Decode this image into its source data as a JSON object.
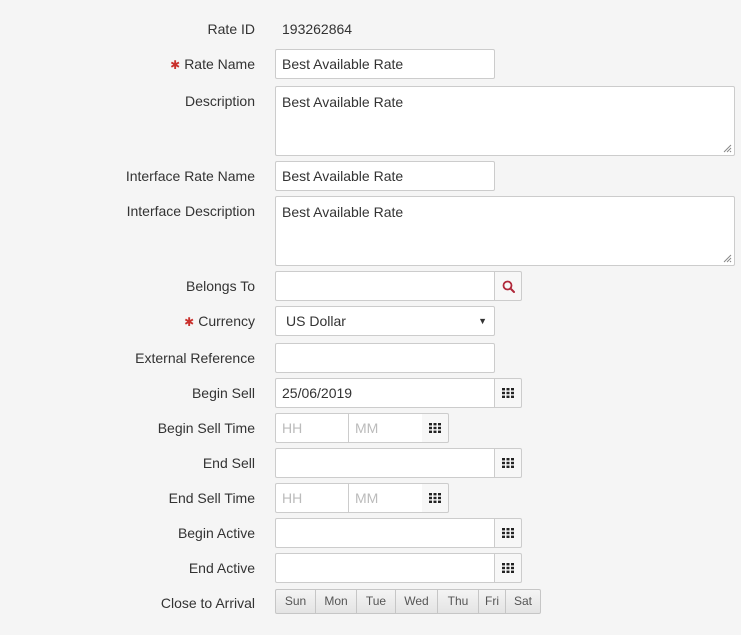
{
  "rate_id": {
    "label": "Rate ID",
    "value": "193262864"
  },
  "rate_name": {
    "label": "Rate Name",
    "required_marker": "✱",
    "value": "Best Available Rate"
  },
  "description": {
    "label": "Description",
    "value": "Best Available Rate"
  },
  "interface_rate_name": {
    "label": "Interface Rate Name",
    "value": "Best Available Rate"
  },
  "interface_description": {
    "label": "Interface Description",
    "value": "Best Available Rate"
  },
  "belongs_to": {
    "label": "Belongs To",
    "value": "",
    "icon": "search-icon"
  },
  "currency": {
    "label": "Currency",
    "required_marker": "✱",
    "value": "US Dollar"
  },
  "external_reference": {
    "label": "External Reference",
    "value": ""
  },
  "begin_sell": {
    "label": "Begin Sell",
    "value": "25/06/2019",
    "icon": "calendar-grid-icon"
  },
  "begin_sell_time": {
    "label": "Begin Sell Time",
    "hh_placeholder": "HH",
    "mm_placeholder": "MM",
    "icon": "clock-grid-icon"
  },
  "end_sell": {
    "label": "End Sell",
    "value": "",
    "icon": "calendar-grid-icon"
  },
  "end_sell_time": {
    "label": "End Sell Time",
    "hh_placeholder": "HH",
    "mm_placeholder": "MM",
    "icon": "clock-grid-icon"
  },
  "begin_active": {
    "label": "Begin Active",
    "value": "",
    "icon": "calendar-grid-icon"
  },
  "end_active": {
    "label": "End Active",
    "value": "",
    "icon": "calendar-grid-icon"
  },
  "close_to_arrival": {
    "label": "Close to Arrival",
    "days": [
      "Sun",
      "Mon",
      "Tue",
      "Wed",
      "Thu",
      "Fri",
      "Sat"
    ]
  },
  "colors": {
    "required": "#c9302c",
    "search_icon": "#b0283a",
    "border": "#cccccc",
    "background": "#f5f5f5"
  }
}
